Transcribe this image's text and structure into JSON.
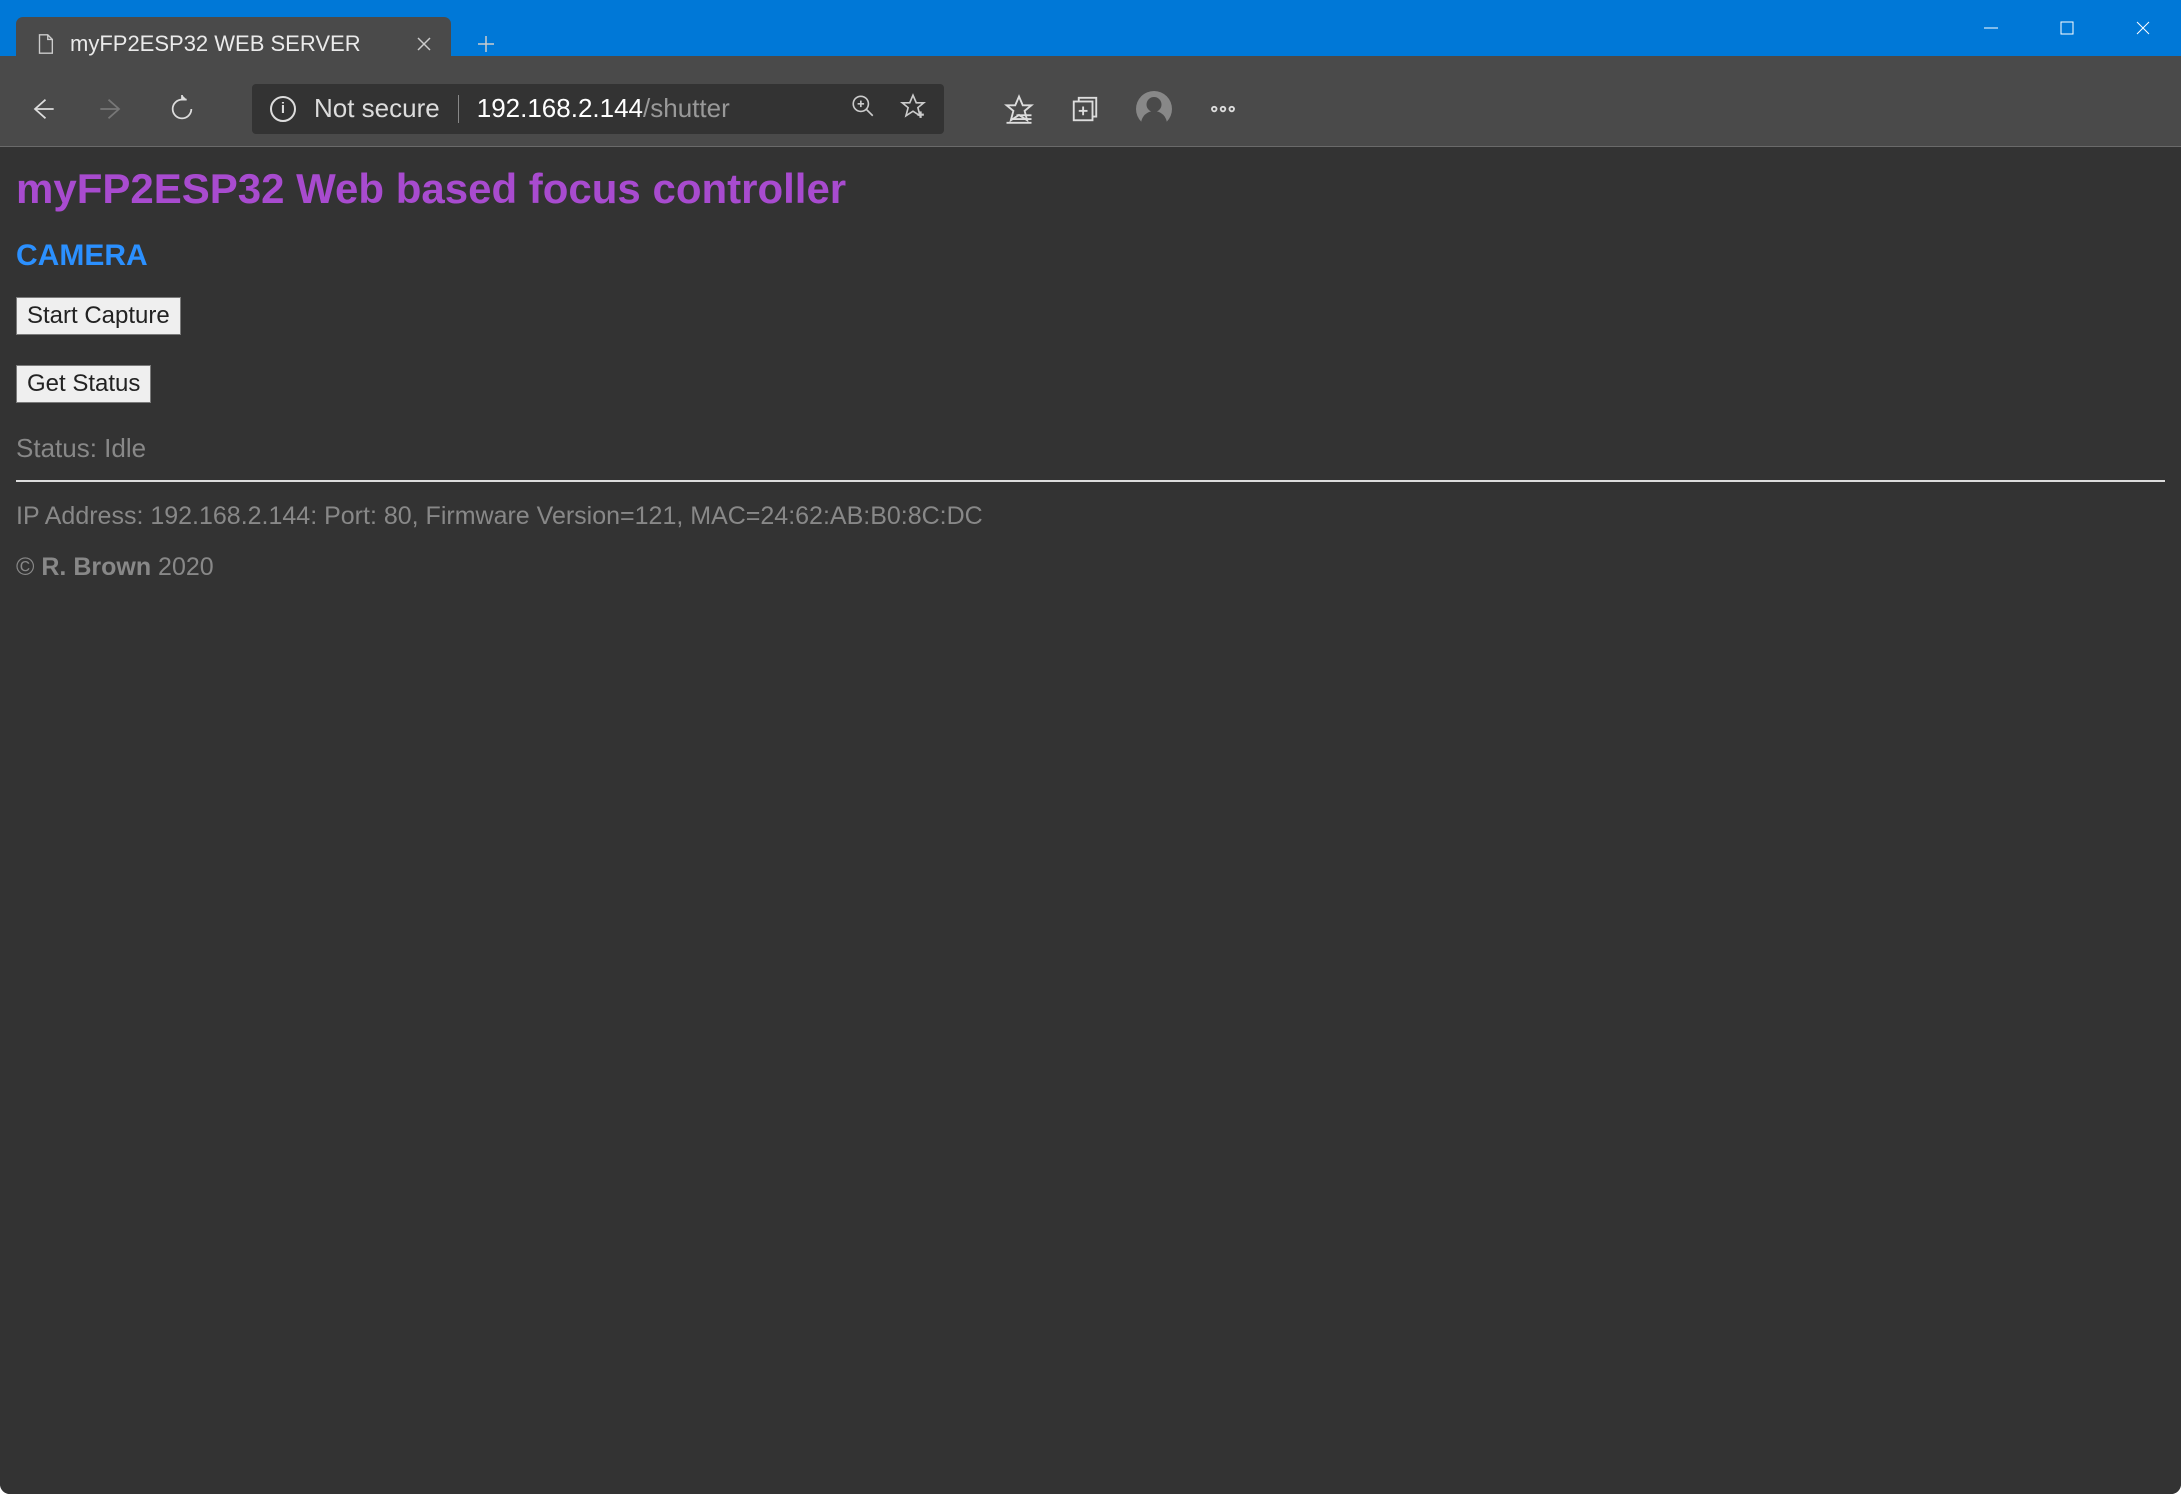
{
  "window": {
    "tab_title": "myFP2ESP32 WEB SERVER"
  },
  "addressbar": {
    "security_label": "Not secure",
    "url_host": "192.168.2.144",
    "url_path": "/shutter"
  },
  "page": {
    "heading": "myFP2ESP32 Web based focus controller",
    "section": "CAMERA",
    "buttons": {
      "start_capture": "Start Capture",
      "get_status": "Get Status"
    },
    "status_label": "Status:",
    "status_value": "Idle",
    "footer_info": "IP Address: 192.168.2.144: Port: 80, Firmware Version=121, MAC=24:62:AB:B0:8C:DC",
    "copyright_symbol": "©",
    "copyright_author": "R. Brown",
    "copyright_year": "2020"
  }
}
